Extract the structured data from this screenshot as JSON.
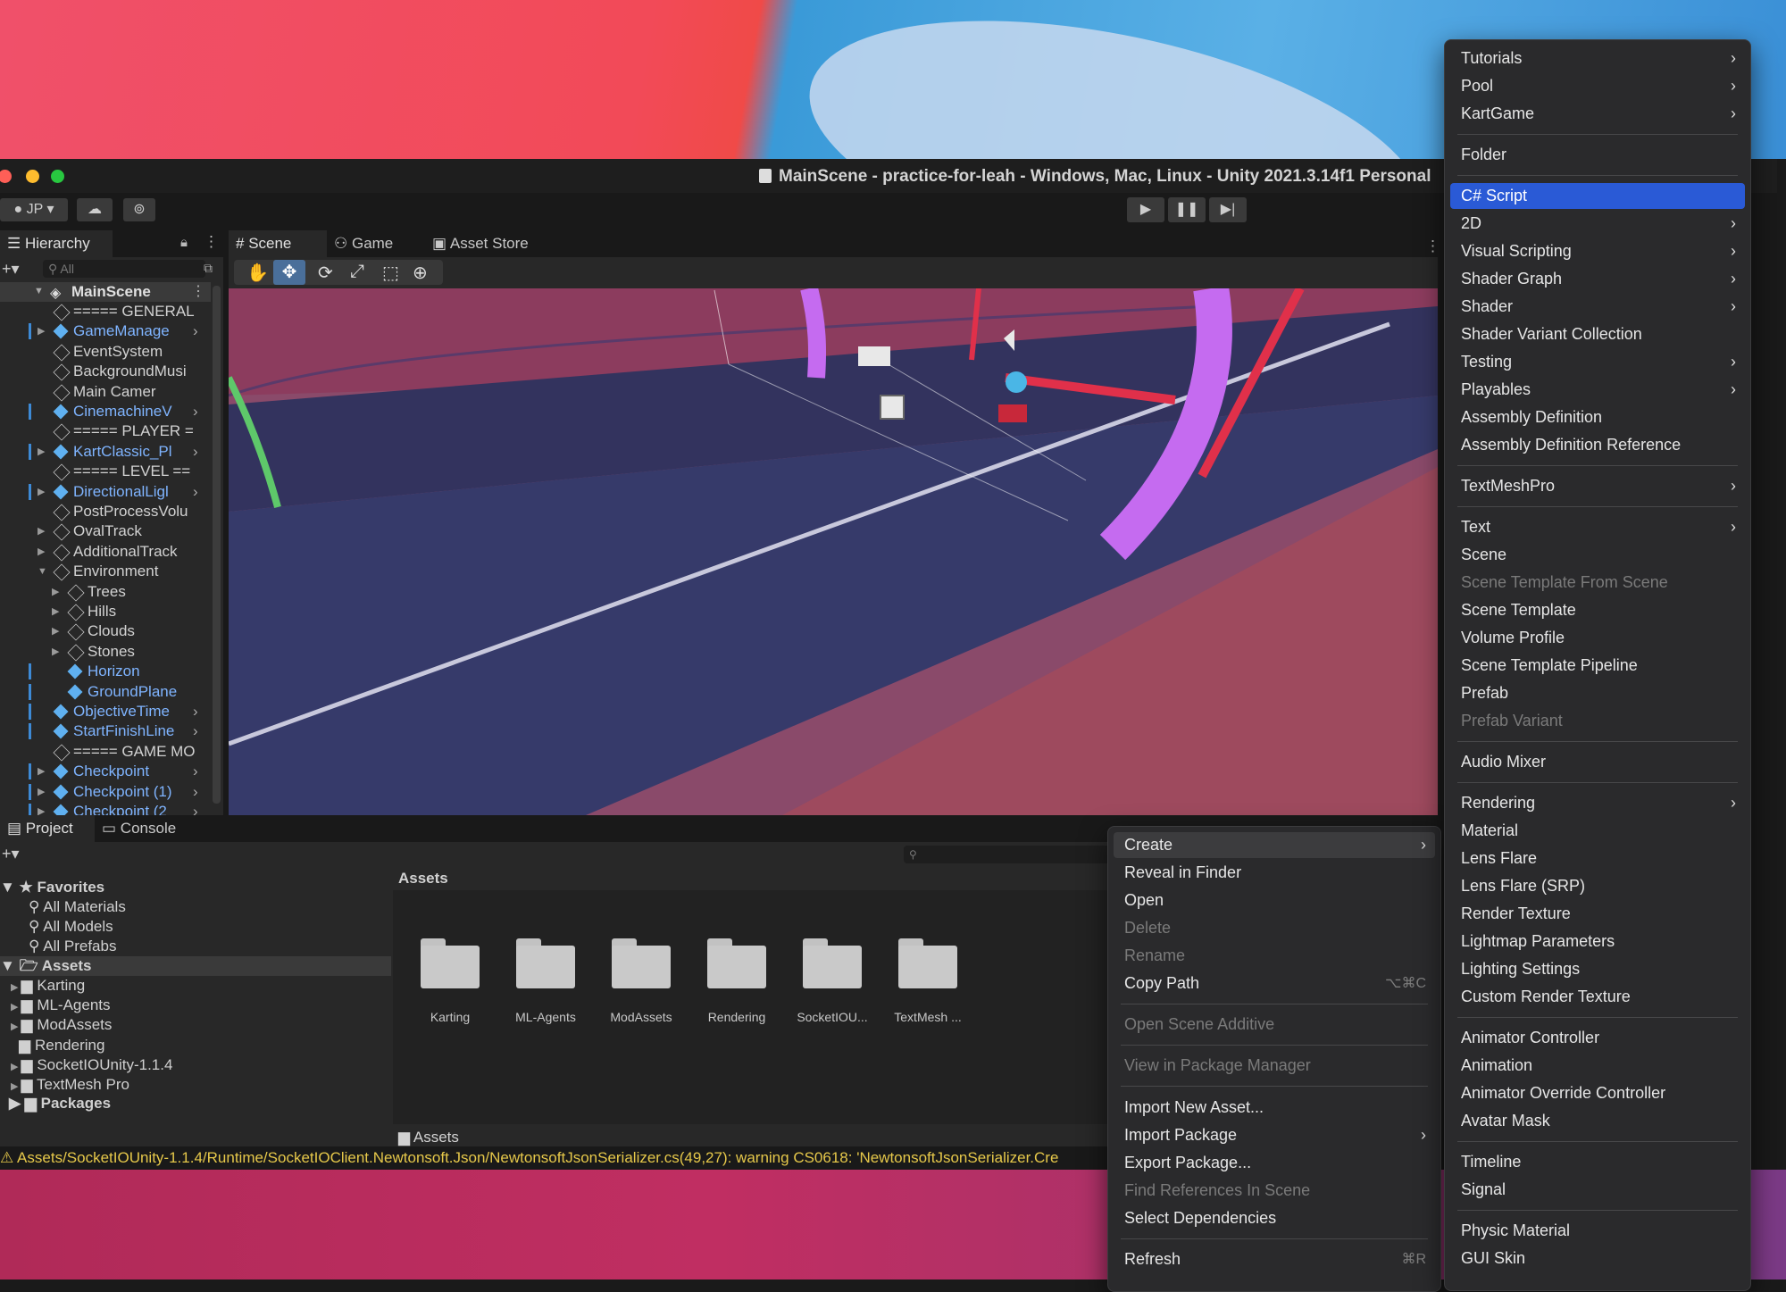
{
  "window": {
    "title": "MainScene - practice-for-leah - Windows, Mac, Linux - Unity 2021.3.14f1 Personal",
    "account": "JP"
  },
  "tabs": {
    "hierarchy": "Hierarchy",
    "scene": "Scene",
    "game": "Game",
    "asset_store": "Asset Store",
    "project": "Project",
    "console": "Console"
  },
  "hierarchy": {
    "search_placeholder": "All",
    "scene_name": "MainScene",
    "items": [
      {
        "label": "===== GENERAL",
        "blue": false
      },
      {
        "label": "GameManage",
        "blue": true
      },
      {
        "label": "EventSystem",
        "blue": false
      },
      {
        "label": "BackgroundMusi",
        "blue": false
      },
      {
        "label": "Main Camer",
        "blue": false
      },
      {
        "label": "CinemachineV",
        "blue": true
      },
      {
        "label": "===== PLAYER =",
        "blue": false
      },
      {
        "label": "KartClassic_Pl",
        "blue": true
      },
      {
        "label": "===== LEVEL ==",
        "blue": false
      },
      {
        "label": "DirectionalLigl",
        "blue": true
      },
      {
        "label": "PostProcessVolu",
        "blue": false
      },
      {
        "label": "OvalTrack",
        "blue": false
      },
      {
        "label": "AdditionalTrack",
        "blue": false
      },
      {
        "label": "Environment",
        "blue": false
      },
      {
        "label": "Trees",
        "blue": false
      },
      {
        "label": "Hills",
        "blue": false
      },
      {
        "label": "Clouds",
        "blue": false
      },
      {
        "label": "Stones",
        "blue": false
      },
      {
        "label": "Horizon",
        "blue": true
      },
      {
        "label": "GroundPlane",
        "blue": true
      },
      {
        "label": "ObjectiveTime",
        "blue": true
      },
      {
        "label": "StartFinishLine",
        "blue": true
      },
      {
        "label": "===== GAME MO",
        "blue": false
      },
      {
        "label": "Checkpoint",
        "blue": true
      },
      {
        "label": "Checkpoint (1)",
        "blue": true
      },
      {
        "label": "Checkpoint (2",
        "blue": true
      }
    ]
  },
  "project": {
    "favorites_label": "Favorites",
    "favorites": [
      "All Materials",
      "All Models",
      "All Prefabs"
    ],
    "assets_label": "Assets",
    "asset_tree": [
      "Karting",
      "ML-Agents",
      "ModAssets",
      "Rendering",
      "SocketIOUnity-1.1.4",
      "TextMesh Pro"
    ],
    "packages_label": "Packages",
    "breadcrumb": "Assets",
    "footer_path": "Assets",
    "folders": [
      "Karting",
      "ML-Agents",
      "ModAssets",
      "Rendering",
      "SocketIOU...",
      "TextMesh ..."
    ]
  },
  "status": {
    "message": "Assets/SocketIOUnity-1.1.4/Runtime/SocketIOClient.Newtonsoft.Json/NewtonsoftJsonSerializer.cs(49,27): warning CS0618: 'NewtonsoftJsonSerializer.Cre"
  },
  "context_menu": {
    "create": "Create",
    "reveal": "Reveal in Finder",
    "open": "Open",
    "delete": "Delete",
    "rename": "Rename",
    "copy_path": "Copy Path",
    "copy_path_shortcut": "⌥⌘C",
    "open_scene_additive": "Open Scene Additive",
    "view_in_package_manager": "View in Package Manager",
    "import_new_asset": "Import New Asset...",
    "import_package": "Import Package",
    "export_package": "Export Package...",
    "find_references": "Find References In Scene",
    "select_dependencies": "Select Dependencies",
    "refresh": "Refresh",
    "refresh_shortcut": "⌘R"
  },
  "create_menu": {
    "tutorials": "Tutorials",
    "pool": "Pool",
    "kartgame": "KartGame",
    "folder": "Folder",
    "csharp_script": "C# Script",
    "two_d": "2D",
    "visual_scripting": "Visual Scripting",
    "shader_graph": "Shader Graph",
    "shader": "Shader",
    "shader_variant_collection": "Shader Variant Collection",
    "testing": "Testing",
    "playables": "Playables",
    "assembly_definition": "Assembly Definition",
    "assembly_definition_reference": "Assembly Definition Reference",
    "textmeshpro": "TextMeshPro",
    "text": "Text",
    "scene": "Scene",
    "scene_template_from_scene": "Scene Template From Scene",
    "scene_template": "Scene Template",
    "volume_profile": "Volume Profile",
    "scene_template_pipeline": "Scene Template Pipeline",
    "prefab": "Prefab",
    "prefab_variant": "Prefab Variant",
    "audio_mixer": "Audio Mixer",
    "rendering": "Rendering",
    "material": "Material",
    "lens_flare": "Lens Flare",
    "lens_flare_srp": "Lens Flare (SRP)",
    "render_texture": "Render Texture",
    "lightmap_parameters": "Lightmap Parameters",
    "lighting_settings": "Lighting Settings",
    "custom_render_texture": "Custom Render Texture",
    "animator_controller": "Animator Controller",
    "animation": "Animation",
    "animator_override_controller": "Animator Override Controller",
    "avatar_mask": "Avatar Mask",
    "timeline": "Timeline",
    "signal": "Signal",
    "physic_material": "Physic Material",
    "gui_skin": "GUI Skin"
  }
}
